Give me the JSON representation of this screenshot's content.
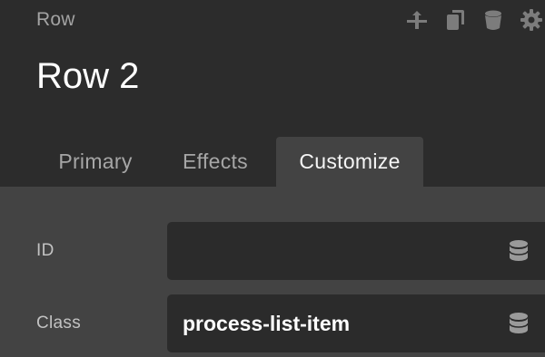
{
  "header": {
    "breadcrumb": "Row",
    "title": "Row 2",
    "toolbar": {
      "icons": [
        "move-icon",
        "duplicate-icon",
        "delete-icon",
        "gear-icon"
      ]
    }
  },
  "tabs": [
    {
      "label": "Primary",
      "active": false
    },
    {
      "label": "Effects",
      "active": false
    },
    {
      "label": "Customize",
      "active": true
    }
  ],
  "fields": {
    "id": {
      "label": "ID",
      "value": "",
      "icon": "database-icon"
    },
    "class": {
      "label": "Class",
      "value": "process-list-item",
      "icon": "database-icon"
    }
  },
  "colors": {
    "header_bg": "#2c2c2c",
    "body_bg": "#434343",
    "field_bg": "#2b2b2b",
    "title_text": "#ffffff",
    "muted_text": "#a3a3a3"
  }
}
